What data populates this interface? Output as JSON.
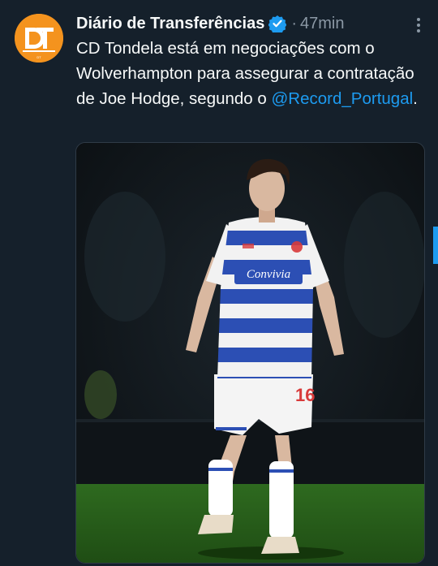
{
  "tweet": {
    "author": "Diário de Transferências",
    "separator": "·",
    "time": "47min",
    "text_before": "CD Tondela está em negociações com o Wolverhampton para assegurar a contratação de Joe Hodge, segundo o ",
    "mention": "@Record_Portugal",
    "text_after": ".",
    "avatar_text": "DT"
  },
  "media": {
    "sponsor_text": "Convivia",
    "shorts_number": "16"
  },
  "colors": {
    "background": "#15202b",
    "accent": "#1d9bf0",
    "avatar": "#f4931e",
    "muted": "#8b98a5",
    "kit_blue": "#2c4fb4"
  },
  "icons": {
    "verified": "verified-badge-icon",
    "more": "more-options-icon"
  }
}
